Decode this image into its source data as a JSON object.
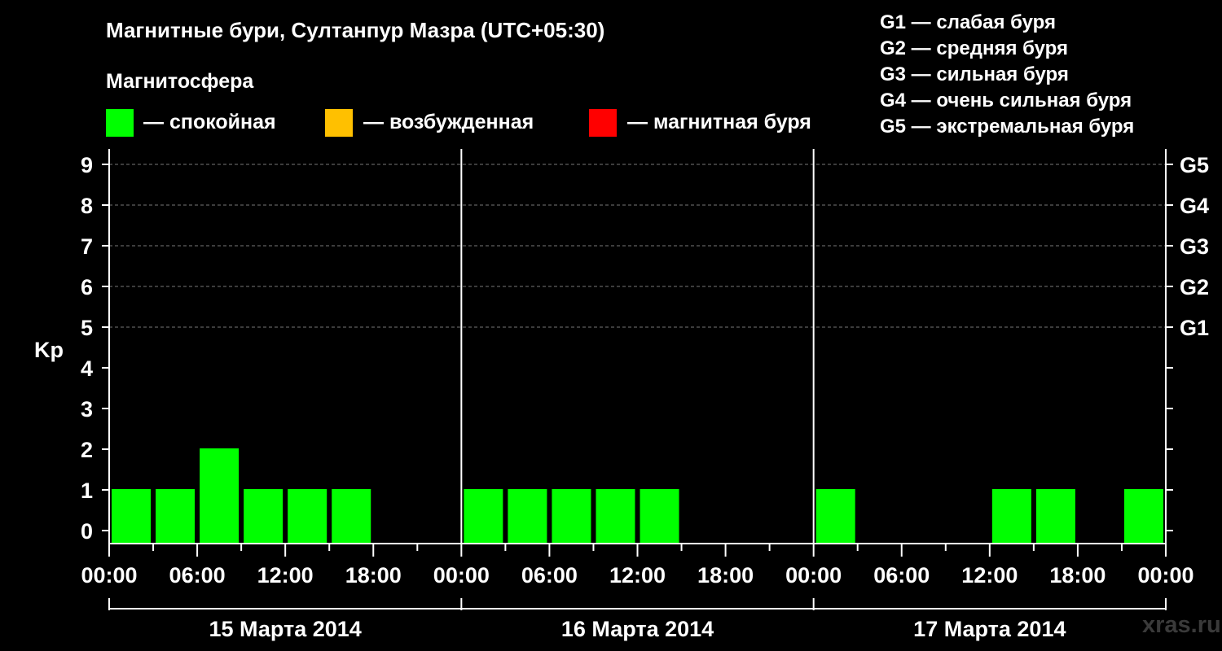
{
  "header": {
    "title": "Магнитные бури, Султанпур Мазра (UTC+05:30)",
    "magnetosphere_title": "Магнитосфера"
  },
  "legend": {
    "items": [
      {
        "label": "— спокойная",
        "color": "#00ff00"
      },
      {
        "label": "— возбужденная",
        "color": "#ffc000"
      },
      {
        "label": "— магнитная буря",
        "color": "#ff0000"
      }
    ],
    "g_scale": [
      "G1 — слабая буря",
      "G2 — средняя буря",
      "G3 — сильная буря",
      "G4 — очень сильная буря",
      "G5 — экстремальная буря"
    ]
  },
  "watermark": "xras.ru",
  "chart_data": {
    "type": "bar",
    "ylabel": "Kp",
    "ylim": [
      0,
      9
    ],
    "yticks": [
      0,
      1,
      2,
      3,
      4,
      5,
      6,
      7,
      8,
      9
    ],
    "right_ticks": [
      {
        "kp": 5,
        "label": "G1"
      },
      {
        "kp": 6,
        "label": "G2"
      },
      {
        "kp": 7,
        "label": "G3"
      },
      {
        "kp": 8,
        "label": "G4"
      },
      {
        "kp": 9,
        "label": "G5"
      }
    ],
    "x_tick_labels": [
      "00:00",
      "06:00",
      "12:00",
      "18:00",
      "00:00",
      "06:00",
      "12:00",
      "18:00",
      "00:00",
      "06:00",
      "12:00",
      "18:00",
      "00:00"
    ],
    "days": [
      "15 Марта 2014",
      "16 Марта 2014",
      "17 Марта 2014"
    ],
    "grid": "dashed horizontal",
    "values": [
      1,
      1,
      2,
      1,
      1,
      1,
      0,
      0,
      1,
      1,
      1,
      1,
      1,
      0,
      0,
      0,
      1,
      0,
      0,
      0,
      1,
      1,
      0,
      1
    ],
    "color": "#00ff00"
  }
}
